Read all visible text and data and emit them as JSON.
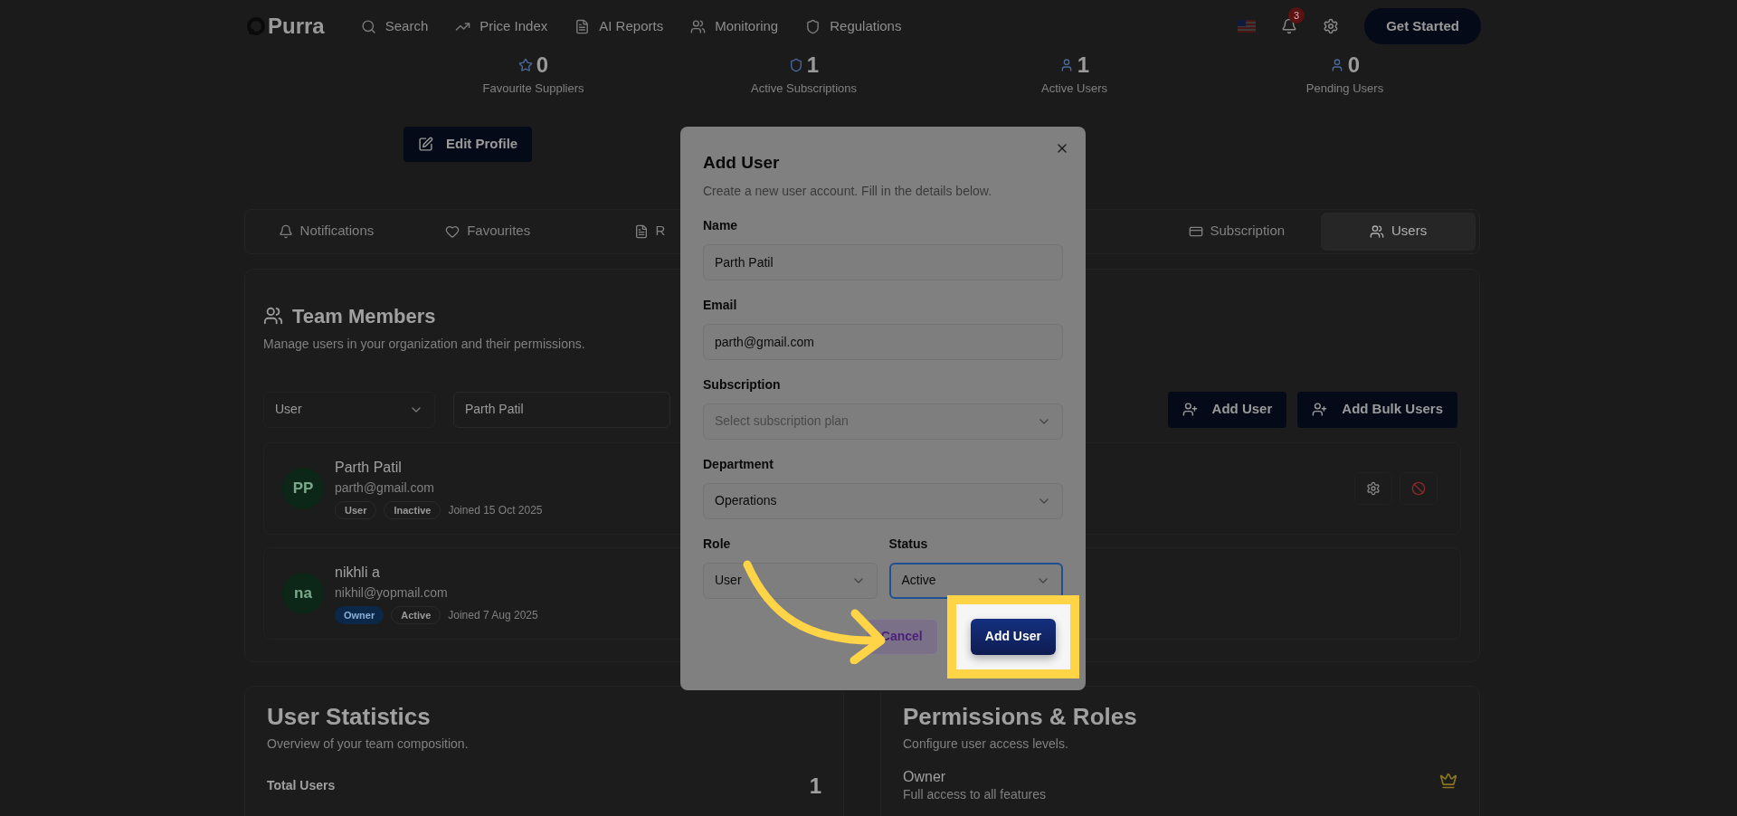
{
  "nav": {
    "logo": "Purra",
    "links": [
      {
        "label": "Search"
      },
      {
        "label": "Price Index"
      },
      {
        "label": "AI Reports"
      },
      {
        "label": "Monitoring"
      },
      {
        "label": "Regulations"
      }
    ],
    "notification_count": "3",
    "cta": "Get Started"
  },
  "profile": {
    "stats": [
      {
        "value": "0",
        "label": "Favourite Suppliers"
      },
      {
        "value": "1",
        "label": "Active Subscriptions"
      },
      {
        "value": "1",
        "label": "Active Users"
      },
      {
        "value": "0",
        "label": "Pending Users"
      }
    ],
    "edit_button": "Edit Profile"
  },
  "tabs": [
    {
      "label": "Notifications",
      "selected": false
    },
    {
      "label": "Favourites",
      "selected": false
    },
    {
      "label": "R",
      "selected": false
    },
    {
      "label": "Subscription",
      "selected": false
    },
    {
      "label": "Users",
      "selected": true
    }
  ],
  "team": {
    "title": "Team Members",
    "subtitle": "Manage users in your organization and their permissions.",
    "role_filter": "User",
    "search_value": "Parth Patil",
    "add_button": "Add User",
    "bulk_button": "Add Bulk Users",
    "members": [
      {
        "initials": "PP",
        "name": "Parth Patil",
        "email": "parth@gmail.com",
        "role": "User",
        "role_highlighted": false,
        "status": "Inactive",
        "joined": "Joined 15 Oct 2025",
        "actions": true
      },
      {
        "initials": "na",
        "name": "nikhli a",
        "email": "nikhil@yopmail.com",
        "role": "Owner",
        "role_highlighted": true,
        "status": "Active",
        "joined": "Joined 7 Aug 2025",
        "actions": false
      }
    ]
  },
  "stats_card": {
    "title": "User Statistics",
    "subtitle": "Overview of your team composition.",
    "rows": [
      {
        "label": "Total Users",
        "value": "1"
      }
    ]
  },
  "permissions": {
    "title": "Permissions & Roles",
    "subtitle": "Configure user access levels.",
    "roles": [
      {
        "name": "Owner",
        "description": "Full access to all features"
      }
    ]
  },
  "dialog": {
    "title": "Add User",
    "description": "Create a new user account. Fill in the details below.",
    "fields": [
      {
        "label": "Name",
        "kind": "input",
        "value": "Parth Patil"
      },
      {
        "label": "Email",
        "kind": "input",
        "value": "parth@gmail.com"
      },
      {
        "label": "Subscription",
        "kind": "select",
        "placeholder": "Select subscription plan"
      },
      {
        "label": "Department",
        "kind": "select",
        "value": "Operations"
      }
    ],
    "pair": [
      {
        "label": "Role",
        "value": "User",
        "focused": false
      },
      {
        "label": "Status",
        "value": "Active",
        "focused": true
      }
    ],
    "cancel": "Cancel",
    "submit": "Add User",
    "submit_highlighted": true
  }
}
